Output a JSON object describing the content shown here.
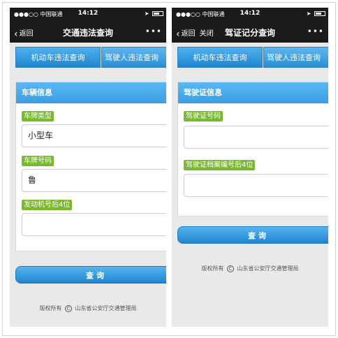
{
  "status": {
    "carrier": "●●●○○ 中国联通",
    "time": "14:12"
  },
  "left": {
    "back_label": "返回",
    "title": "交通违法查询",
    "tabs": [
      "机动车违法查询",
      "驾驶人违法查询"
    ],
    "card_title": "车辆信息",
    "fields": [
      {
        "label": "车牌类型",
        "value": "小型车"
      },
      {
        "label": "车牌号码",
        "value": "鲁"
      },
      {
        "label": "发动机号后4位",
        "value": ""
      }
    ],
    "query_label": "查询",
    "footer_prefix": "版权所有",
    "footer_org": "山东省公安厅交通管理局"
  },
  "right": {
    "back_label": "返回",
    "close_label": "关闭",
    "title": "驾证记分查询",
    "tabs": [
      "机动车违法查询",
      "驾驶人违法查询"
    ],
    "card_title": "驾驶证信息",
    "fields": [
      {
        "label": "驾驶证号码",
        "value": ""
      },
      {
        "label": "驾驶证档案编号后4位",
        "value": ""
      }
    ],
    "query_label": "查询",
    "footer_prefix": "版权所有",
    "footer_org": "山东省公安厅交通管理局"
  },
  "colors": {
    "accent_blue": "#3a9ee2",
    "label_green": "#7ab82d",
    "bar_dark": "#1b1b1b"
  }
}
